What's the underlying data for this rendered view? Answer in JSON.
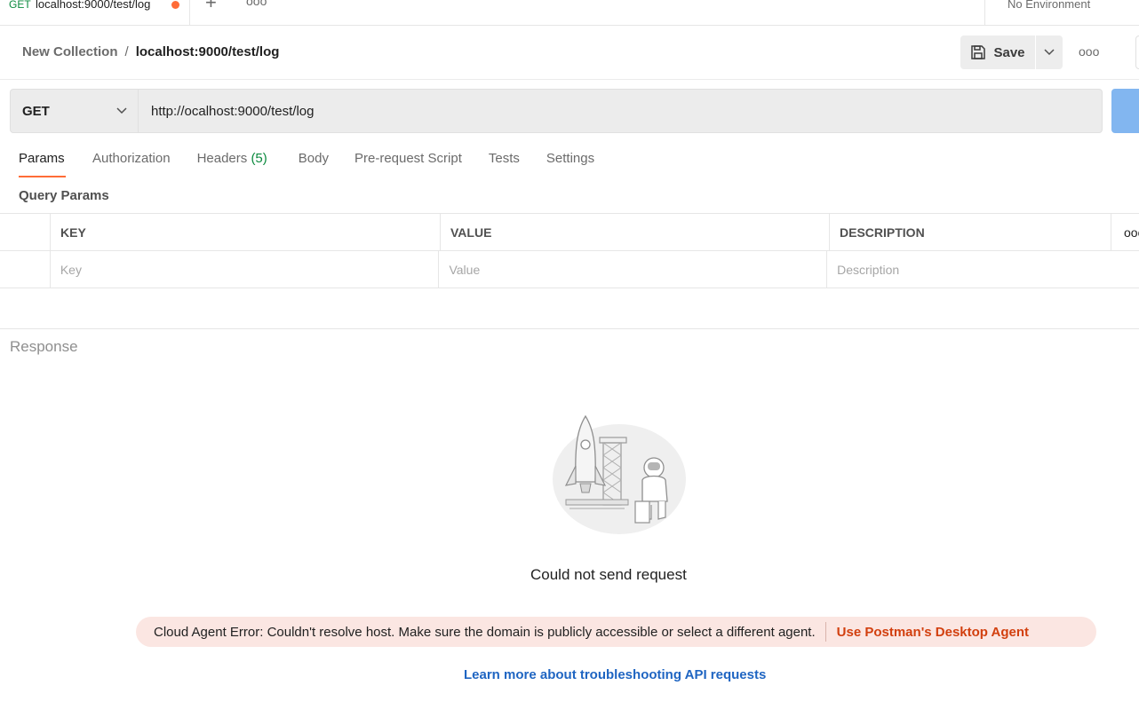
{
  "tab": {
    "method": "GET",
    "title": "localhost:9000/test/log",
    "plus": "+",
    "more": "ooo"
  },
  "environment": {
    "label": "No Environment"
  },
  "breadcrumb": {
    "parent": "New Collection",
    "separator": "/",
    "current": "localhost:9000/test/log"
  },
  "toolbar": {
    "save_label": "Save",
    "more": "ooo"
  },
  "request": {
    "method": "GET",
    "url": "http://ocalhost:9000/test/log"
  },
  "request_tabs": [
    {
      "label": "Params",
      "active": true
    },
    {
      "label": "Authorization"
    },
    {
      "label": "Headers",
      "count": "(5)"
    },
    {
      "label": "Body"
    },
    {
      "label": "Pre-request Script"
    },
    {
      "label": "Tests"
    },
    {
      "label": "Settings"
    }
  ],
  "params": {
    "section_title": "Query Params",
    "columns": [
      "KEY",
      "VALUE",
      "DESCRIPTION"
    ],
    "more": "ooo",
    "placeholders": {
      "key": "Key",
      "value": "Value",
      "description": "Description"
    }
  },
  "response": {
    "label": "Response",
    "empty_title": "Could not send request",
    "error_text": "Cloud Agent Error: Couldn't resolve host. Make sure the domain is publicly accessible or select a different agent.",
    "error_action": "Use Postman's Desktop Agent",
    "learn_more": "Learn more about troubleshooting API requests"
  },
  "colors": {
    "accent": "#ff6c37",
    "send_button": "#82b6f0",
    "link": "#1f65c2",
    "error_bg": "#fbe6e2",
    "error_link": "#d23f0e",
    "method_green": "#0b8a3e"
  }
}
